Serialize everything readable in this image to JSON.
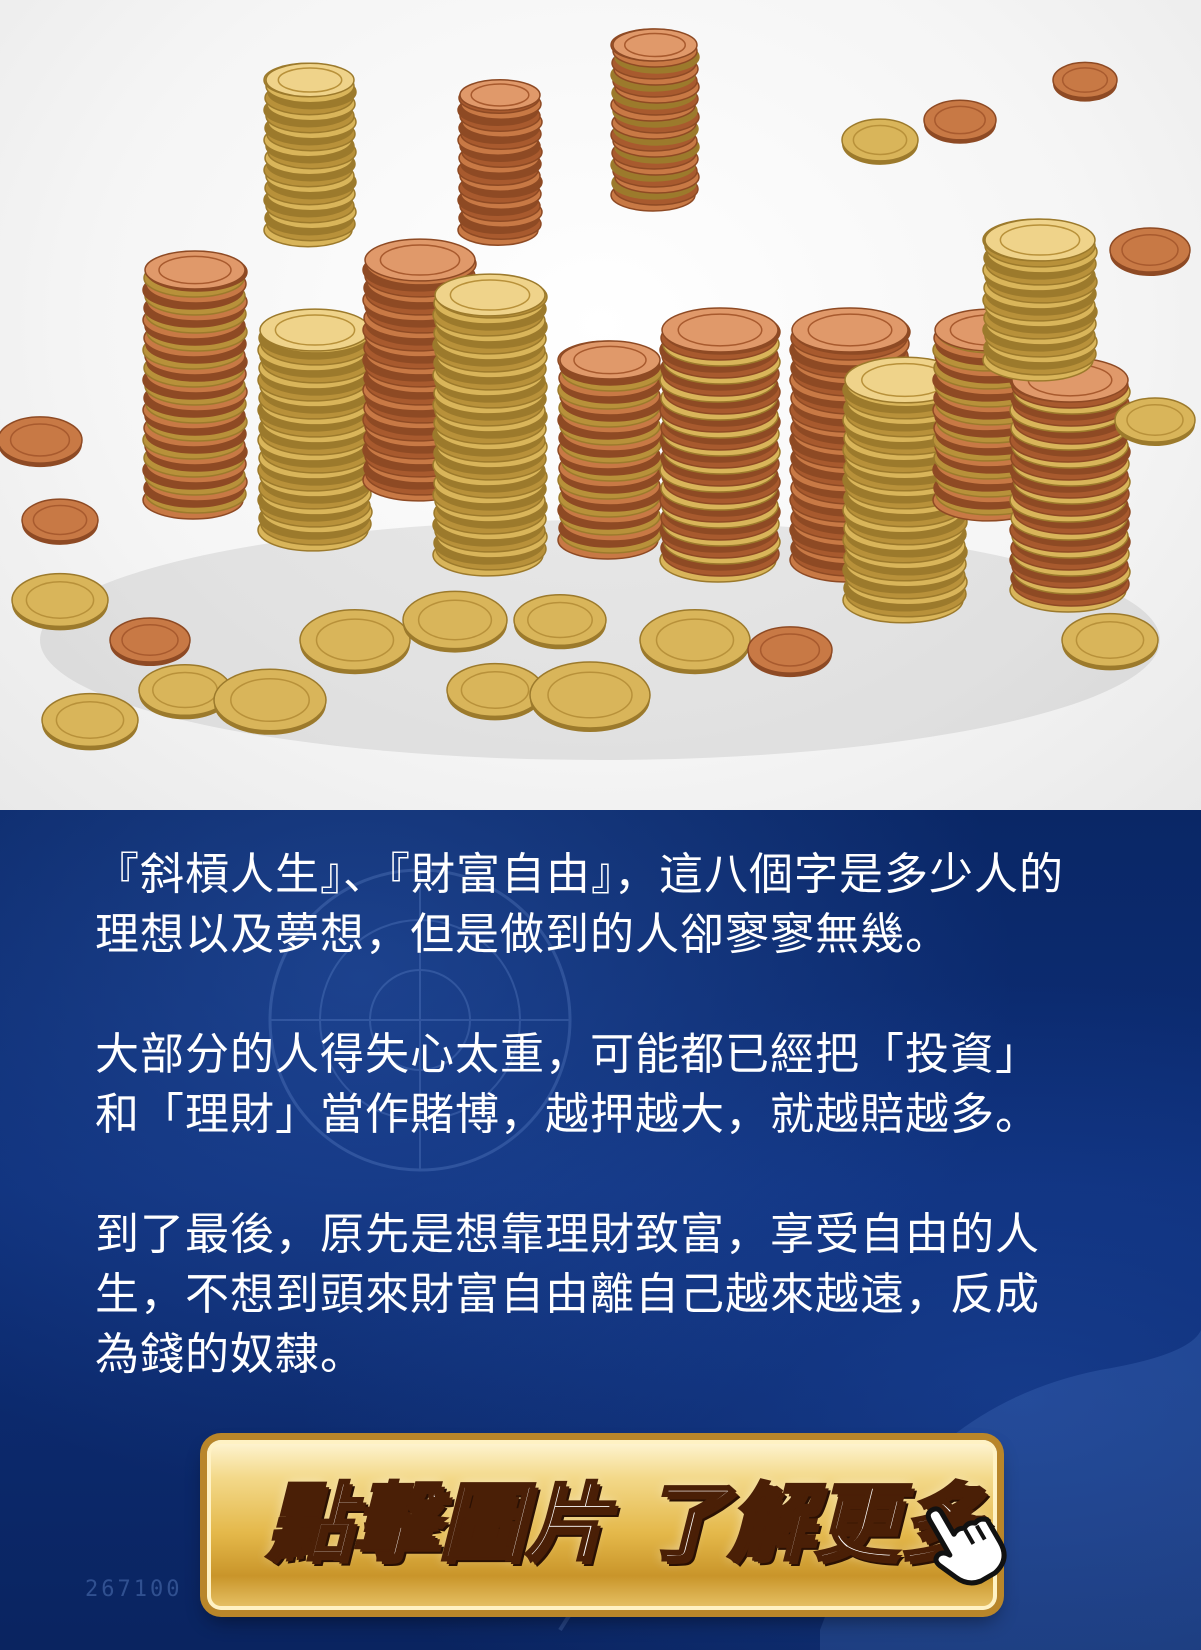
{
  "image": {
    "subject": "stacks of euro coins",
    "icon": "coins-photo"
  },
  "paragraphs": [
    {
      "line1": "『斜槓人生』、『財富自由』，這八個字是多少人的",
      "line2": "理想以及夢想，但是做到的人卻寥寥無幾。"
    },
    {
      "line1": "大部分的人得失心太重，可能都已經把「投資」",
      "line2": "和「理財」當作賭博，越押越大，就越賠越多。"
    },
    {
      "line1": "到了最後，原先是想靠理財致富，享受自由的人",
      "line2": "生，不想到頭來財富自由離自己越來越遠，反成",
      "line3": "為錢的奴隸。"
    }
  ],
  "cta": {
    "label": "點擊圖片 了解更多",
    "icon": "pointing-hand-icon"
  },
  "watermark": "267100",
  "colors": {
    "panel_background": "#0b2a6b",
    "text": "#ffffff",
    "button_gold": "#e4b84a",
    "button_text_outline": "#4a1f06"
  }
}
